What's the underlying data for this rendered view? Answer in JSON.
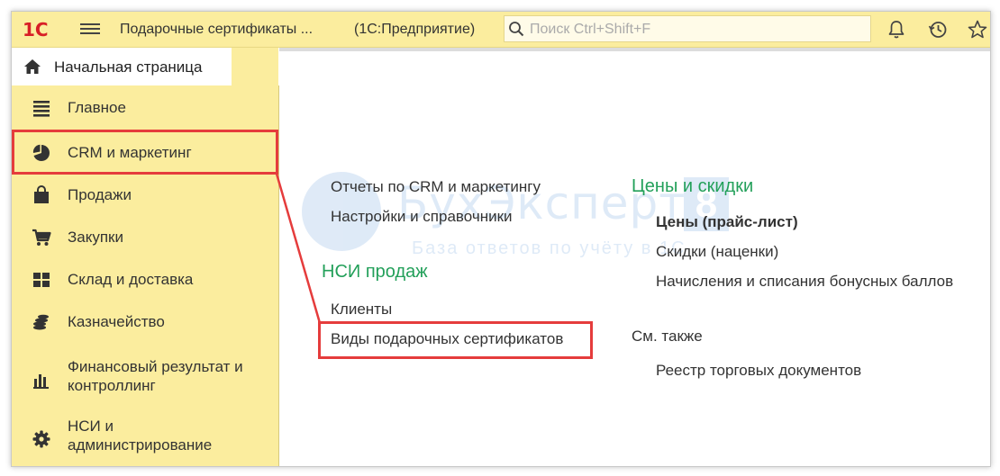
{
  "header": {
    "logo_text": "1С",
    "title": "Подарочные сертификаты ...",
    "platform": "(1С:Предприятие)",
    "search_placeholder": "Поиск Ctrl+Shift+F",
    "icons": [
      "bell-icon",
      "history-icon",
      "star-icon"
    ]
  },
  "home_tab": {
    "label": "Начальная страница"
  },
  "sidebar": {
    "items": [
      {
        "label": "Главное",
        "icon": "list-icon"
      },
      {
        "label": "CRM и маркетинг",
        "icon": "pie-chart-icon",
        "active": true
      },
      {
        "label": "Продажи",
        "icon": "shopping-bag-icon"
      },
      {
        "label": "Закупки",
        "icon": "cart-icon"
      },
      {
        "label": "Склад и доставка",
        "icon": "warehouse-grid-icon"
      },
      {
        "label": "Казначейство",
        "icon": "coins-icon"
      },
      {
        "label": "Финансовый результат и контроллинг",
        "icon": "bar-chart-icon"
      },
      {
        "label": "НСИ и администрирование",
        "icon": "gear-icon"
      }
    ]
  },
  "content": {
    "left_links": [
      "Отчеты по CRM и маркетингу",
      "Настройки и справочники"
    ],
    "nsi_section": {
      "heading": "НСИ продаж",
      "links": [
        "Клиенты",
        "Виды подарочных сертификатов"
      ]
    },
    "prices_section": {
      "heading": "Цены и скидки",
      "links": [
        "Цены (прайс-лист)",
        "Скидки (наценки)",
        "Начисления и списания бонусных баллов"
      ]
    },
    "see_also": {
      "heading": "См. также",
      "links": [
        "Реестр торговых документов"
      ]
    }
  },
  "watermark": {
    "brand": "БухЭксперт",
    "number": "8",
    "tagline": "База ответов по учёту в 1С"
  },
  "colors": {
    "topbar_bg": "#fbed9e",
    "section_green": "#23a05a",
    "highlight_red": "#e53c3c",
    "tab_underline": "#2aa66d"
  }
}
